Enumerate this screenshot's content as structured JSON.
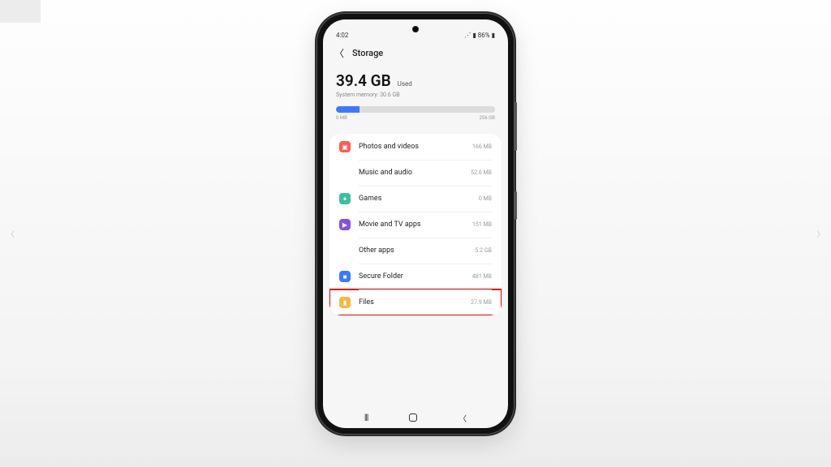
{
  "status": {
    "time": "4:02",
    "battery": "86%"
  },
  "header": {
    "title": "Storage"
  },
  "summary": {
    "used_amount": "39.4 GB",
    "used_label": "Used",
    "system_line": "System memory: 30.6 GB",
    "bar_min": "0 MB",
    "bar_max": "256 GB"
  },
  "categories": [
    {
      "id": "photos",
      "icon": "photos-icon",
      "label": "Photos and videos",
      "size": "166 MB",
      "highlight": false
    },
    {
      "id": "music",
      "icon": "music-icon",
      "label": "Music and audio",
      "size": "52.6 MB",
      "highlight": false
    },
    {
      "id": "games",
      "icon": "games-icon",
      "label": "Games",
      "size": "0 MB",
      "highlight": false
    },
    {
      "id": "movie",
      "icon": "movie-icon",
      "label": "Movie and TV apps",
      "size": "151 MB",
      "highlight": false
    },
    {
      "id": "other",
      "icon": "apps-icon",
      "label": "Other apps",
      "size": "5.2 GB",
      "highlight": false
    },
    {
      "id": "secure",
      "icon": "secure-icon",
      "label": "Secure Folder",
      "size": "481 MB",
      "highlight": false
    },
    {
      "id": "files",
      "icon": "files-icon",
      "label": "Files",
      "size": "27.9 MB",
      "highlight": true
    }
  ]
}
